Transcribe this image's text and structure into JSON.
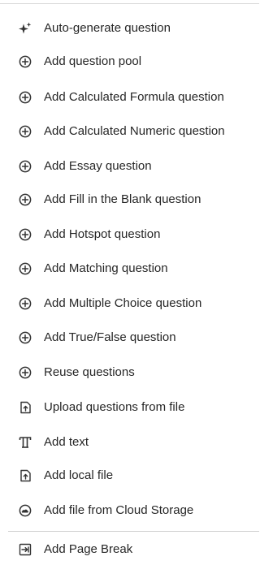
{
  "menu": {
    "items": [
      {
        "label": "Auto-generate question",
        "icon": "sparkle-icon"
      },
      {
        "label": "Add question pool",
        "icon": "plus-circle-icon"
      },
      {
        "label": "Add Calculated Formula question",
        "icon": "plus-circle-icon"
      },
      {
        "label": "Add Calculated Numeric question",
        "icon": "plus-circle-icon"
      },
      {
        "label": "Add Essay question",
        "icon": "plus-circle-icon"
      },
      {
        "label": "Add Fill in the Blank question",
        "icon": "plus-circle-icon"
      },
      {
        "label": "Add Hotspot question",
        "icon": "plus-circle-icon"
      },
      {
        "label": "Add Matching question",
        "icon": "plus-circle-icon"
      },
      {
        "label": "Add Multiple Choice question",
        "icon": "plus-circle-icon"
      },
      {
        "label": "Add True/False question",
        "icon": "plus-circle-icon"
      },
      {
        "label": "Reuse questions",
        "icon": "plus-circle-icon"
      },
      {
        "label": "Upload questions from file",
        "icon": "file-upload-icon"
      },
      {
        "label": "Add text",
        "icon": "text-icon"
      },
      {
        "label": "Add local file",
        "icon": "file-upload-icon"
      },
      {
        "label": "Add file from Cloud Storage",
        "icon": "cloud-upload-icon"
      },
      {
        "label": "Add Page Break",
        "icon": "page-break-icon"
      }
    ]
  },
  "colors": {
    "text": "#262626",
    "icon": "#333333",
    "divider": "#cfcfcf"
  }
}
